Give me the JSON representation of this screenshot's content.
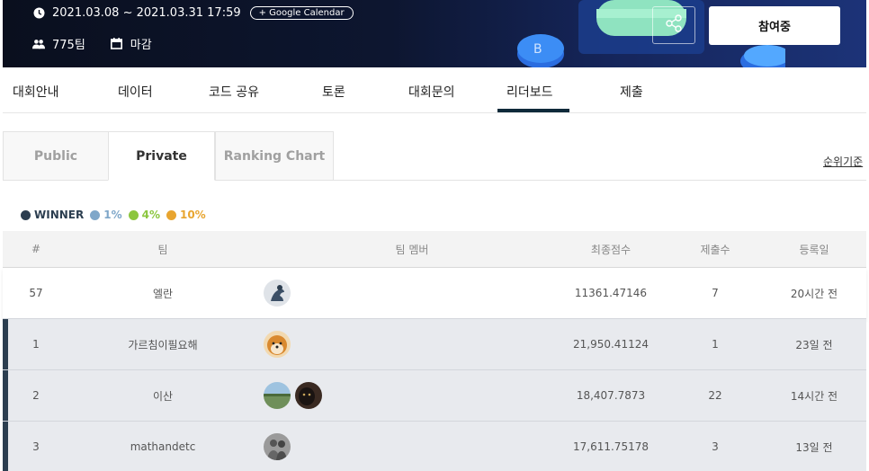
{
  "banner": {
    "period": "2021.03.08 ~ 2021.03.31 17:59",
    "gcal_label": "+ Google Calendar",
    "team_count": "775팀",
    "status": "마감",
    "join_label": "참여중"
  },
  "nav": {
    "items": [
      "대회안내",
      "데이터",
      "코드 공유",
      "토론",
      "대회문의",
      "리더보드",
      "제출"
    ],
    "active": "리더보드"
  },
  "subtabs": {
    "items": [
      "Public",
      "Private",
      "Ranking Chart"
    ],
    "active": "Private"
  },
  "criteria_label": "순위기준",
  "legend": [
    {
      "label": "WINNER",
      "color": "#2c3e50"
    },
    {
      "label": "1%",
      "color": "#7fa7c9"
    },
    {
      "label": "4%",
      "color": "#8cc63f"
    },
    {
      "label": "10%",
      "color": "#e8a530"
    }
  ],
  "table": {
    "headers": {
      "rank": "#",
      "team": "팀",
      "members": "팀 멤버",
      "score": "최종점수",
      "subs": "제출수",
      "date": "등록일"
    },
    "my_row": {
      "rank": "57",
      "team": "엘란",
      "score": "11361.47146",
      "subs": "7",
      "date": "20시간 전",
      "avatars": [
        "avatar-photo-1"
      ]
    },
    "rows": [
      {
        "rank": "1",
        "team": "가르침이필요해",
        "score": "21,950.41124",
        "subs": "1",
        "date": "23일 전",
        "avatars": [
          "avatar-shiba-dog"
        ]
      },
      {
        "rank": "2",
        "team": "이산",
        "score": "18,407.7873",
        "subs": "22",
        "date": "14시간 전",
        "avatars": [
          "avatar-landscape",
          "avatar-cat"
        ]
      },
      {
        "rank": "3",
        "team": "mathandetc",
        "score": "17,611.75178",
        "subs": "3",
        "date": "13일 전",
        "avatars": [
          "avatar-people-photo"
        ]
      }
    ]
  }
}
